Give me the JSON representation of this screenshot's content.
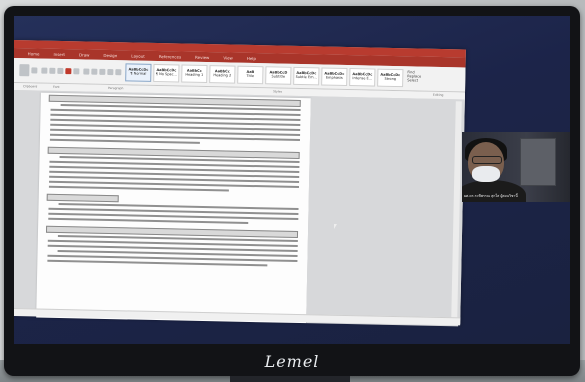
{
  "monitor": {
    "brand": "Lemel"
  },
  "word": {
    "tabs": [
      "Home",
      "Insert",
      "Draw",
      "Design",
      "Layout",
      "References",
      "Review",
      "View",
      "Help"
    ],
    "styles": [
      {
        "sample": "AaBbCcDc",
        "name": "¶ Normal",
        "selected": true
      },
      {
        "sample": "AaBbCcDc",
        "name": "¶ No Spac..."
      },
      {
        "sample": "AaBbCc",
        "name": "Heading 1"
      },
      {
        "sample": "AaBbCc",
        "name": "Heading 2"
      },
      {
        "sample": "AaB",
        "name": "Title"
      },
      {
        "sample": "AaBbCcD",
        "name": "Subtitle"
      },
      {
        "sample": "AaBbCcDc",
        "name": "Subtle Em..."
      },
      {
        "sample": "AaBbCcDc",
        "name": "Emphasis"
      },
      {
        "sample": "AaBbCcDc",
        "name": "Intense E..."
      },
      {
        "sample": "AaBbCcDc",
        "name": "Strong"
      }
    ],
    "groups": [
      "Clipboard",
      "Font",
      "Paragraph",
      "Styles",
      "Editing"
    ],
    "editing": [
      "Find",
      "Replace",
      "Select"
    ]
  },
  "video": {
    "participant_label": "ผศ.ดร.ระพีพรรณ สุกใส ผู้สอนวิชานี้"
  }
}
